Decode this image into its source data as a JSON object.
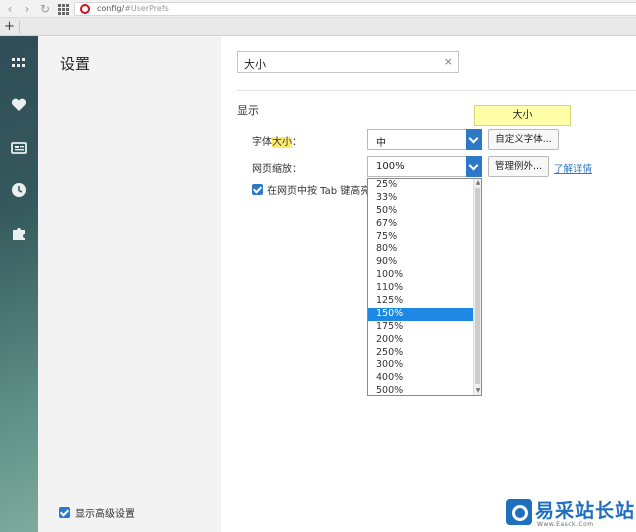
{
  "browser": {
    "url_prefix": "config/",
    "url_rest": "#UserPrefs",
    "new_tab": "+"
  },
  "rail": {
    "icons": [
      "speed-dial-icon",
      "heart-icon",
      "news-icon",
      "history-icon",
      "extensions-icon"
    ]
  },
  "nav": {
    "title": "设置",
    "advanced_label": "显示高级设置",
    "advanced_checked": true
  },
  "search": {
    "value": "大小",
    "clear": "×"
  },
  "display": {
    "section_title": "显示",
    "font_size": {
      "label_prefix": "字体",
      "label_highlight": "大小",
      "label_suffix": "：",
      "value": "中",
      "custom_button": "自定义字体..."
    },
    "zoom": {
      "label": "网页缩放：",
      "value": "100%",
      "exceptions_button": "管理例外...",
      "learn_more": "了解详情"
    },
    "tab_highlight": {
      "label": "在网页中按 Tab 键高亮",
      "checked": true
    },
    "tooltip": "大小"
  },
  "zoom_options": [
    "25%",
    "33%",
    "50%",
    "67%",
    "75%",
    "80%",
    "90%",
    "100%",
    "110%",
    "125%",
    "150%",
    "175%",
    "200%",
    "250%",
    "300%",
    "400%",
    "500%"
  ],
  "zoom_selected": "150%",
  "watermark": {
    "text": "易采站长站",
    "sub": "Www.Easck.Com"
  },
  "colors": {
    "accent": "#2d79c7",
    "selection": "#1e88e5",
    "highlight": "#ffeb6b",
    "tooltip_bg": "#ffffa8"
  }
}
